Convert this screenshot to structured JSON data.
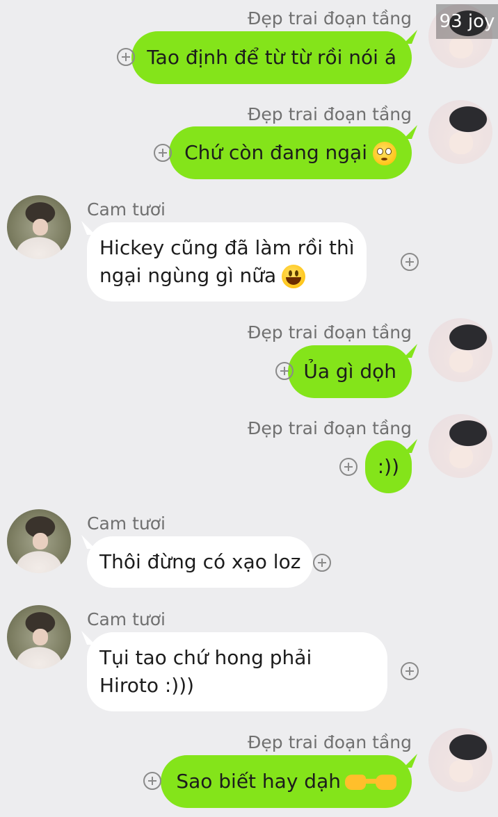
{
  "watermark": "93 joy",
  "messages": [
    {
      "sender": "Đẹp trai đoạn tầng",
      "text": "Tao định để từ từ rồi nói á",
      "emoji": ""
    },
    {
      "sender": "Đẹp trai đoạn tầng",
      "text": "Chứ còn đang ngại",
      "emoji": "flushed-face"
    },
    {
      "sender": "Cam tươi",
      "line1": "Hickey cũng đã làm rồi thì",
      "line2": "ngại ngùng gì nữa",
      "emoji": "grinning-face"
    },
    {
      "sender": "Đẹp trai đoạn tầng",
      "text": "Ủa gì dọh",
      "emoji": ""
    },
    {
      "sender": "Đẹp trai đoạn tầng",
      "text": ":))",
      "emoji": ""
    },
    {
      "sender": "Cam tươi",
      "text": "Thôi đừng có xạo loz",
      "emoji": ""
    },
    {
      "sender": "Cam tươi",
      "line1": "Tụi tao chứ hong phải",
      "line2": "Hiroto :)))",
      "emoji": ""
    },
    {
      "sender": "Đẹp trai đoạn tầng",
      "text": "Sao biết hay dạh",
      "emoji": "pointing-hands"
    }
  ],
  "colors": {
    "background": "#ededef",
    "my_bubble": "#84e41a",
    "their_bubble": "#ffffff",
    "name_text": "#707070"
  },
  "icons": {
    "add": "plus-circle-icon",
    "my_avatar": "avatar-dep-trai",
    "their_avatar": "avatar-cam-tuoi"
  }
}
